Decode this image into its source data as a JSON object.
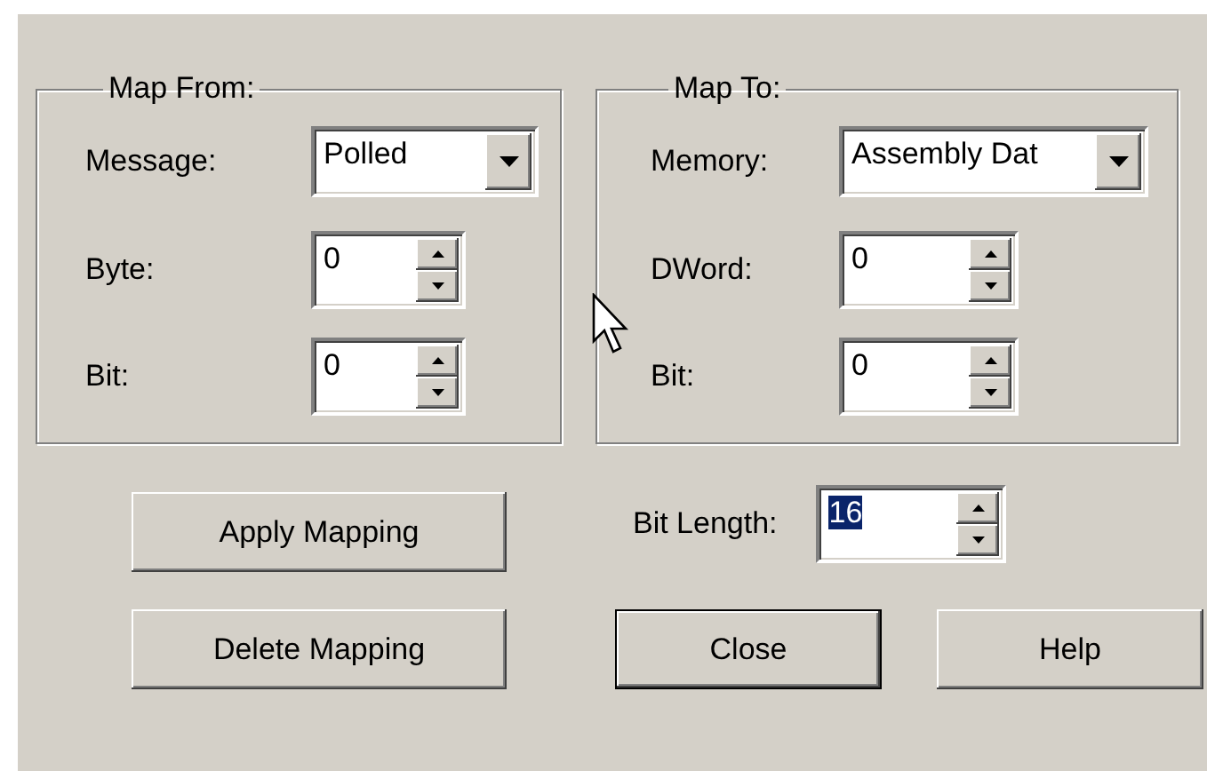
{
  "map_from": {
    "title": "Map From:",
    "fields": [
      {
        "kind": "combo",
        "label": "Message:",
        "value": "Polled"
      },
      {
        "kind": "spin",
        "label": "Byte:",
        "value": "0"
      },
      {
        "kind": "spin",
        "label": "Bit:",
        "value": "0"
      }
    ]
  },
  "map_to": {
    "title": "Map To:",
    "fields": [
      {
        "kind": "combo",
        "label": "Memory:",
        "value": "Assembly Dat"
      },
      {
        "kind": "spin",
        "label": "DWord:",
        "value": "0"
      },
      {
        "kind": "spin",
        "label": "Bit:",
        "value": "0"
      }
    ]
  },
  "bit_length": {
    "label": "Bit Length:",
    "value": "16",
    "text_selected": true
  },
  "buttons": [
    {
      "label": "Apply Mapping",
      "default": false
    },
    {
      "label": "Delete Mapping",
      "default": false
    },
    {
      "label": "Close",
      "default": true
    },
    {
      "label": "Help",
      "default": false
    }
  ]
}
